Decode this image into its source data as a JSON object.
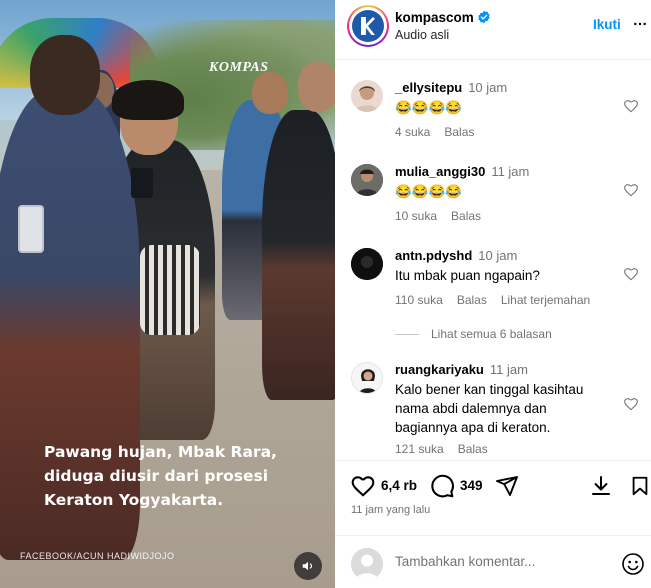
{
  "video": {
    "watermark": "KOMPAS",
    "caption_lines": [
      "Pawang hujan, Mbak Rara,",
      "diduga diusir dari prosesi",
      "Keraton Yogyakarta."
    ],
    "credit": "FACEBOOK/ACUN HADIWIDJOJO",
    "sound_icon": "speaker-icon"
  },
  "post": {
    "account": "kompascom",
    "verified": true,
    "subtitle": "Audio asli",
    "follow_label": "Ikuti",
    "likes": "6,4 rb",
    "comments_count": "349",
    "time_ago": "11 jam yang lalu",
    "composer_placeholder": "Tambahkan komentar..."
  },
  "comments": [
    {
      "user": "_ellysitepu",
      "time": "10 jam",
      "text": "😂😂😂😂",
      "likes": "4 suka",
      "reply": "Balas",
      "translate": ""
    },
    {
      "user": "mulia_anggi30",
      "time": "11 jam",
      "text": "😂😂😂😂",
      "likes": "10 suka",
      "reply": "Balas",
      "translate": ""
    },
    {
      "user": "antn.pdyshd",
      "time": "10 jam",
      "text": "Itu mbak puan ngapain?",
      "likes": "110 suka",
      "reply": "Balas",
      "translate": "Lihat terjemahan",
      "view_replies": "Lihat semua 6 balasan"
    },
    {
      "user": "ruangkariyaku",
      "time": "11 jam",
      "text": "Kalo bener kan tinggal kasihtau nama abdi dalemnya dan bagiannya apa di keraton.",
      "likes": "121 suka",
      "reply": "Balas",
      "translate": ""
    }
  ],
  "colors": {
    "accent": "#0095f6",
    "secondary_text": "#737373"
  }
}
